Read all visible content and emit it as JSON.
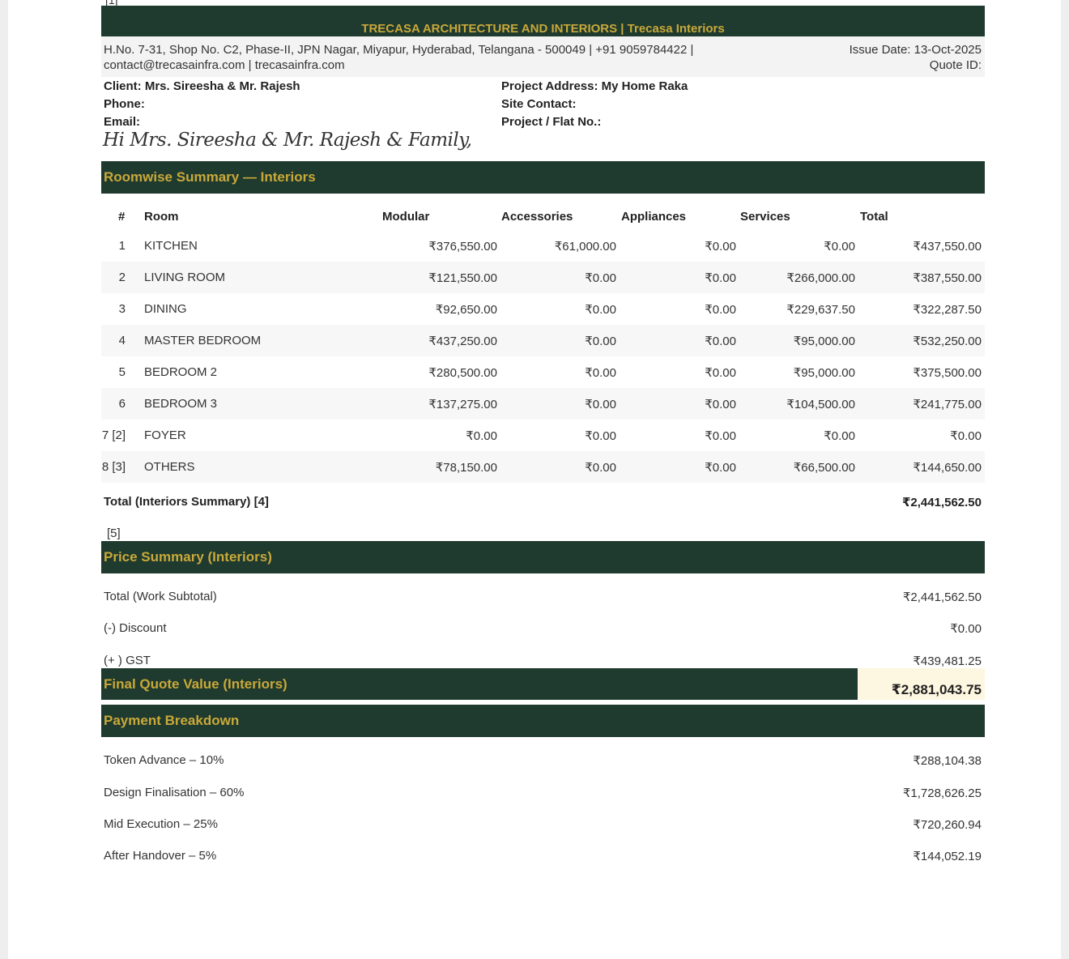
{
  "top_ref": "[1]",
  "header": {
    "banner": "TRECASA ARCHITECTURE AND INTERIORS | Trecasa Interiors",
    "address_line1": "H.No. 7-31, Shop No. C2, Phase-II, JPN Nagar, Miyapur, Hyderabad, Telangana - 500049 | +91 9059784422 |",
    "address_line2": "contact@trecasainfra.com | trecasainfra.com",
    "issue_date": "Issue Date: 13-Oct-2025",
    "quote_id": "Quote ID:"
  },
  "client": {
    "client": "Client: Mrs. Sireesha & Mr. Rajesh",
    "phone": "Phone:",
    "email": "Email:",
    "project_address": "Project Address: My Home Raka",
    "site_contact": "Site Contact:",
    "flat_no": "Project / Flat No.:",
    "greeting": "Hi Mrs. Sireesha & Mr. Rajesh & Family,"
  },
  "roomwise": {
    "title": "Roomwise Summary — Interiors",
    "columns": [
      "#",
      "Room",
      "Modular",
      "Accessories",
      "Appliances",
      "Services",
      "Total"
    ],
    "rows": [
      [
        "1",
        "KITCHEN",
        "₹376,550.00",
        "₹61,000.00",
        "₹0.00",
        "₹0.00",
        "₹437,550.00"
      ],
      [
        "2",
        "LIVING ROOM",
        "₹121,550.00",
        "₹0.00",
        "₹0.00",
        "₹266,000.00",
        "₹387,550.00"
      ],
      [
        "3",
        "DINING",
        "₹92,650.00",
        "₹0.00",
        "₹0.00",
        "₹229,637.50",
        "₹322,287.50"
      ],
      [
        "4",
        "MASTER BEDROOM",
        "₹437,250.00",
        "₹0.00",
        "₹0.00",
        "₹95,000.00",
        "₹532,250.00"
      ],
      [
        "5",
        "BEDROOM 2",
        "₹280,500.00",
        "₹0.00",
        "₹0.00",
        "₹95,000.00",
        "₹375,500.00"
      ],
      [
        "6",
        "BEDROOM 3",
        "₹137,275.00",
        "₹0.00",
        "₹0.00",
        "₹104,500.00",
        "₹241,775.00"
      ],
      [
        "7 [2]",
        "FOYER",
        "₹0.00",
        "₹0.00",
        "₹0.00",
        "₹0.00",
        "₹0.00"
      ],
      [
        "8 [3]",
        "OTHERS",
        "₹78,150.00",
        "₹0.00",
        "₹0.00",
        "₹66,500.00",
        "₹144,650.00"
      ]
    ],
    "total_label": "Total (Interiors Summary) [4]",
    "total_value": "₹2,441,562.50",
    "note": "[5]"
  },
  "price_summary": {
    "title": "Price Summary (Interiors)",
    "subtotal_label": "Total (Work Subtotal)",
    "subtotal_value": "₹2,441,562.50",
    "discount_label": "(-) Discount",
    "discount_value": "₹0.00",
    "gst_label": "(+ ) GST",
    "gst_value": "₹439,481.25",
    "final_label": "Final Quote Value (Interiors)",
    "final_value": "₹2,881,043.75"
  },
  "payment": {
    "title": "Payment Breakdown",
    "items": [
      {
        "label": "Token Advance – 10%",
        "value": "₹288,104.38"
      },
      {
        "label": "Design Finalisation – 60%",
        "value": "₹1,728,626.25"
      },
      {
        "label": "Mid Execution – 25%",
        "value": "₹720,260.94"
      },
      {
        "label": "After Handover – 5%",
        "value": "₹144,052.19"
      }
    ]
  },
  "colors": {
    "banner_bg": "#1f3a2e",
    "banner_text": "#c9a93a",
    "final_value_bg": "#fdf6e0"
  }
}
